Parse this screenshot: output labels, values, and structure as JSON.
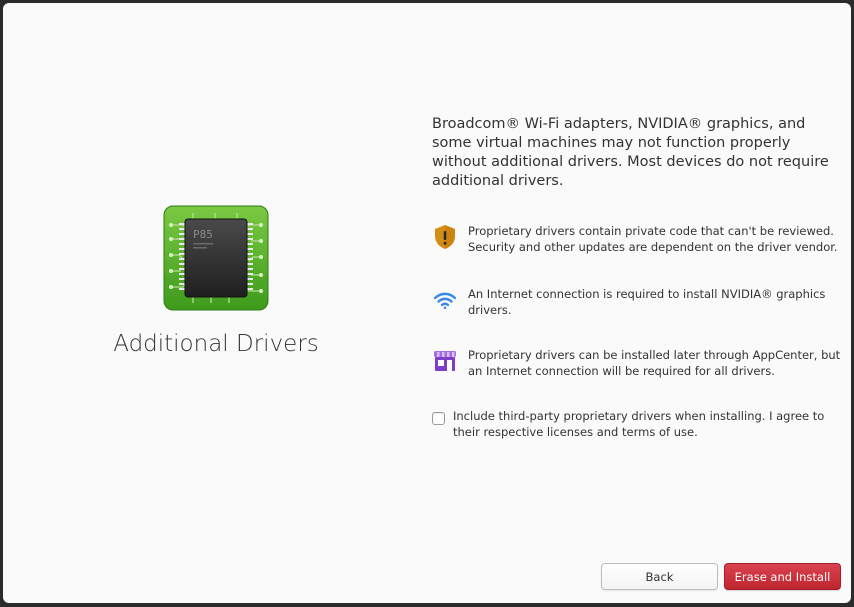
{
  "sidebar": {
    "chip_label": "P85",
    "title": "Additional Drivers"
  },
  "main": {
    "description": "Broadcom® Wi-Fi adapters, NVIDIA® graphics, and some virtual machines may not function properly without additional drivers. Most devices do not require additional drivers.",
    "info_items": [
      {
        "icon": "shield-warning-icon",
        "text": "Proprietary drivers contain private code that can't be reviewed. Security and other updates are dependent on the driver vendor."
      },
      {
        "icon": "wifi-icon",
        "text": "An Internet connection is required to install NVIDIA® graphics drivers."
      },
      {
        "icon": "appcenter-store-icon",
        "text": "Proprietary drivers can be installed later through AppCenter, but an Internet connection will be required for all drivers."
      }
    ],
    "checkbox": {
      "checked": false,
      "label": "Include third-party proprietary drivers when installing. I agree to their respective licenses and terms of use."
    }
  },
  "footer": {
    "back_label": "Back",
    "install_label": "Erase and Install"
  },
  "colors": {
    "destructive": "#c6262e",
    "warning": "#d48e15",
    "wifi": "#3689e6",
    "store": "#a56de2",
    "chip_green": "#68b723"
  }
}
